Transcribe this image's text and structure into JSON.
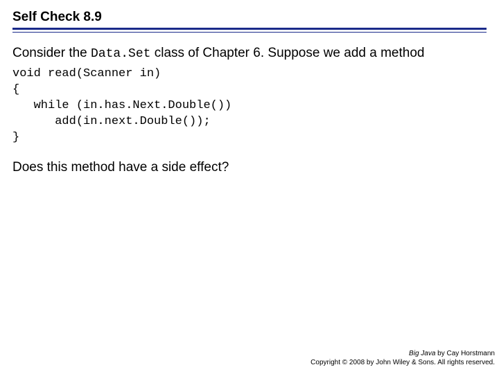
{
  "title": "Self Check 8.9",
  "intro_before": "Consider the ",
  "intro_code": "Data.Set",
  "intro_after": " class of Chapter 6. Suppose we add a method",
  "code": "void read(Scanner in)\n{\n   while (in.has.Next.Double())\n      add(in.next.Double());\n}",
  "question": "Does this method have a side effect?",
  "footer_book": "Big Java",
  "footer_author": " by Cay Horstmann",
  "footer_copyright": "Copyright © 2008 by John Wiley & Sons. All rights reserved."
}
